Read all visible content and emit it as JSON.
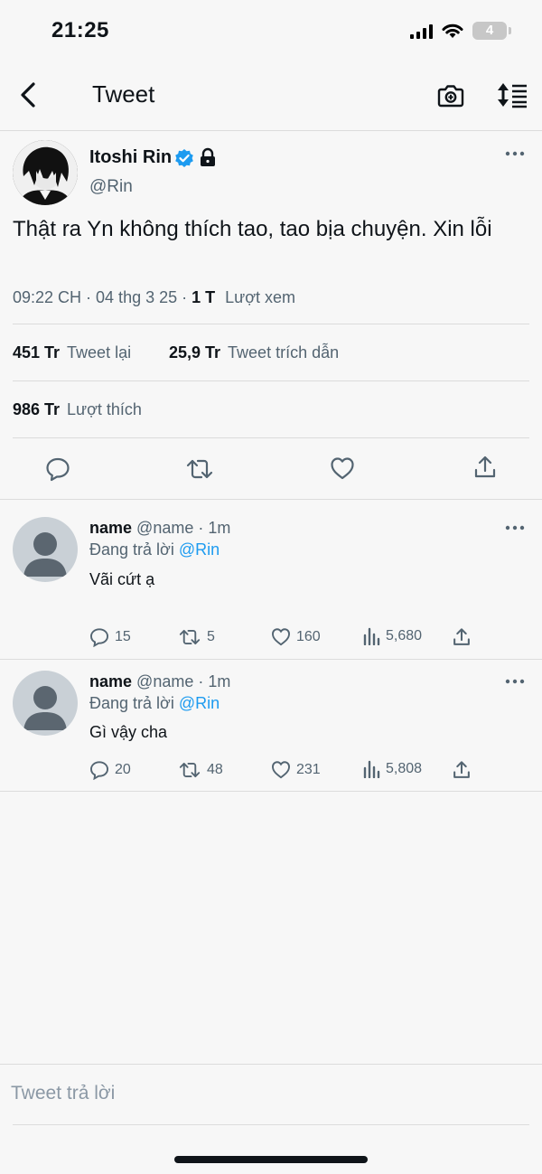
{
  "status_bar": {
    "time": "21:25",
    "battery": "4"
  },
  "header": {
    "title": "Tweet"
  },
  "tweet": {
    "display_name": "Itoshi Rin",
    "handle": "@Rin",
    "text": "Thật ra Yn không thích tao, tao bịa chuyện. Xin lỗi",
    "time": "09:22 CH · 04 thg 3 25 ·",
    "views_count": "1 T",
    "views_label": "Lượt xem",
    "retweets_count": "451 Tr",
    "retweets_label": "Tweet lại",
    "quotes_count": "25,9 Tr",
    "quotes_label": "Tweet trích dẫn",
    "likes_count": "986 Tr",
    "likes_label": "Lượt thích"
  },
  "replies": [
    {
      "name": "name",
      "handle": "@name",
      "time": "· 1m",
      "replying_prefix": "Đang trả lời",
      "replying_to": "@Rin",
      "text": "Vãi cứt ạ",
      "replies": "15",
      "retweets": "5",
      "likes": "160",
      "views": "5,680"
    },
    {
      "name": "name",
      "handle": "@name",
      "time": "· 1m",
      "replying_prefix": "Đang trả lời",
      "replying_to": "@Rin",
      "text": "Gì vậy cha",
      "replies": "20",
      "retweets": "48",
      "likes": "231",
      "views": "5,808"
    }
  ],
  "composer": {
    "placeholder": "Tweet trả lời"
  },
  "colors": {
    "accent": "#1d9bf0",
    "muted": "#536471",
    "text": "#0f1419",
    "background": "#f7f7f7"
  },
  "icons": [
    "back-arrow-icon",
    "camera-icon",
    "sort-icon",
    "verified-icon",
    "lock-icon",
    "more-icon",
    "reply-icon",
    "retweet-icon",
    "like-icon",
    "share-icon",
    "views-icon"
  ]
}
